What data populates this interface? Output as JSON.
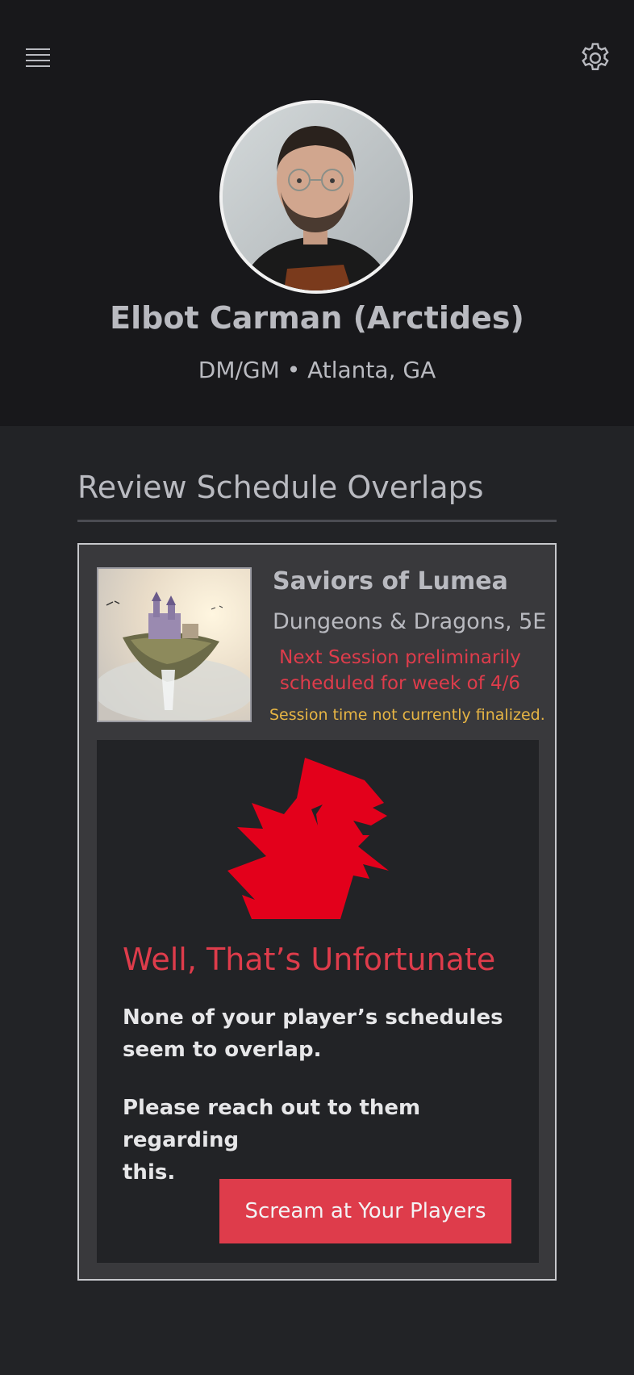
{
  "header": {
    "menu_icon": "hamburger-menu-icon",
    "settings_icon": "gear-icon",
    "profile": {
      "name": "Elbot Carman (Arctides)",
      "meta": "DM/GM • Atlanta, GA"
    }
  },
  "section": {
    "title": "Review Schedule Overlaps"
  },
  "campaign": {
    "title": "Saviors of Lumea",
    "system": "Dungeons & Dragons, 5E",
    "next_session_line1": "Next Session preliminarily",
    "next_session_line2": "scheduled for week of 4/6",
    "session_note": "Session time not currently finalized."
  },
  "message": {
    "title": "Well, That’s Unfortunate",
    "line1a": "None of your player’s schedules",
    "line1b": "seem to overlap.",
    "line2a": "Please reach out to them regarding",
    "line2b": "this.",
    "button_label": "Scream at Your Players"
  },
  "colors": {
    "accent_red": "#de3c4b",
    "warning_yellow": "#e7b544",
    "header_bg": "#18181b",
    "page_bg": "#222326",
    "card_bg": "#39393c"
  }
}
